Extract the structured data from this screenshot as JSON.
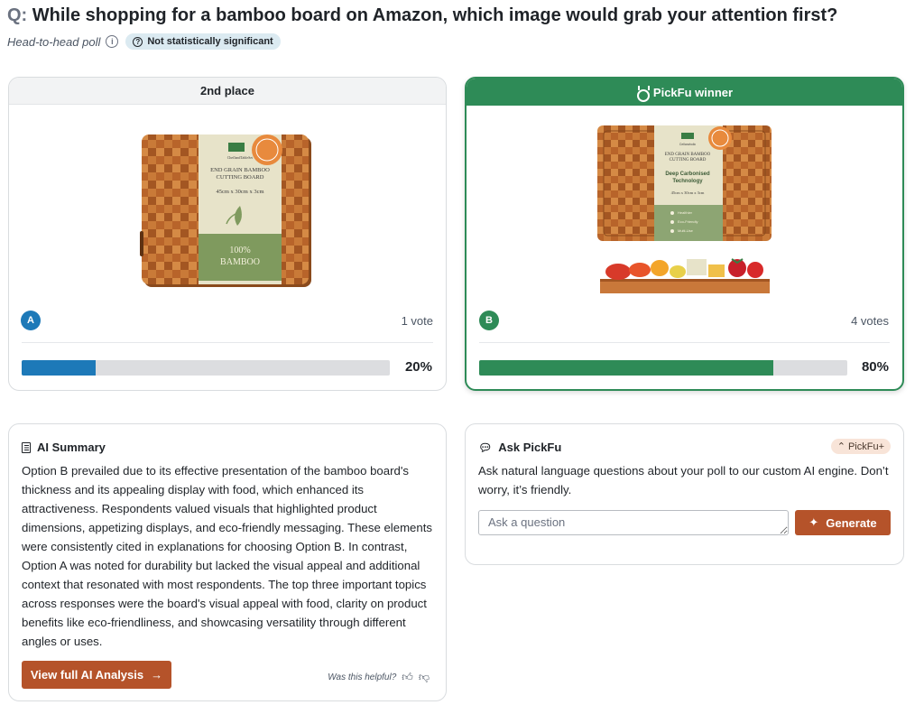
{
  "question": {
    "prefix": "Q:",
    "text": "While shopping for a bamboo board on Amazon, which image would grab your attention first?"
  },
  "meta": {
    "poll_type": "Head-to-head poll",
    "significance": "Not statistically significant"
  },
  "options": [
    {
      "header": "2nd place",
      "letter": "A",
      "votes": "1 vote",
      "percent_label": "20%",
      "percent": 20,
      "product": {
        "brand": "CheflandTableSet",
        "line1": "END GRAIN BAMBOO",
        "line2": "CUTTING BOARD",
        "size": "45cm x 30cm x 3cm",
        "band1": "100%",
        "band2": "BAMBOO"
      }
    },
    {
      "header": "PickFu winner",
      "letter": "B",
      "votes": "4 votes",
      "percent_label": "80%",
      "percent": 80,
      "product": {
        "brand": "Cellaraholic",
        "line1": "END GRAIN BAMBOO",
        "line2": "CUTTING BOARD",
        "feature1": "Deep Carbonised",
        "feature2": "Technology",
        "size": "45cm x 30cm x 3cm",
        "bullet1": "Healthier",
        "bullet2": "Eco-Friendly",
        "bullet3": "Multi-Use"
      }
    }
  ],
  "summary": {
    "title": "AI Summary",
    "text": "Option B prevailed due to its effective presentation of the bamboo board's thickness and its appealing display with food, which enhanced its attractiveness. Respondents valued visuals that highlighted product dimensions, appetizing displays, and eco-friendly messaging. These elements were consistently cited in explanations for choosing Option B. In contrast, Option A was noted for durability but lacked the visual appeal and additional context that resonated with most respondents. The top three important topics across responses were the board's visual appeal with food, clarity on product benefits like eco-friendliness, and showcasing versatility through different angles or uses.",
    "button": "View full AI Analysis",
    "helpful": "Was this helpful?"
  },
  "ask": {
    "title": "Ask PickFu",
    "badge": "PickFu+",
    "description": "Ask natural language questions about your poll to our custom AI engine. Don’t worry, it’s friendly.",
    "placeholder": "Ask a question",
    "button": "Generate"
  },
  "colors": {
    "option_a": "#1d79b8",
    "option_b": "#2e8b57",
    "action": "#b5532a",
    "bar_track": "#dcdde0"
  }
}
